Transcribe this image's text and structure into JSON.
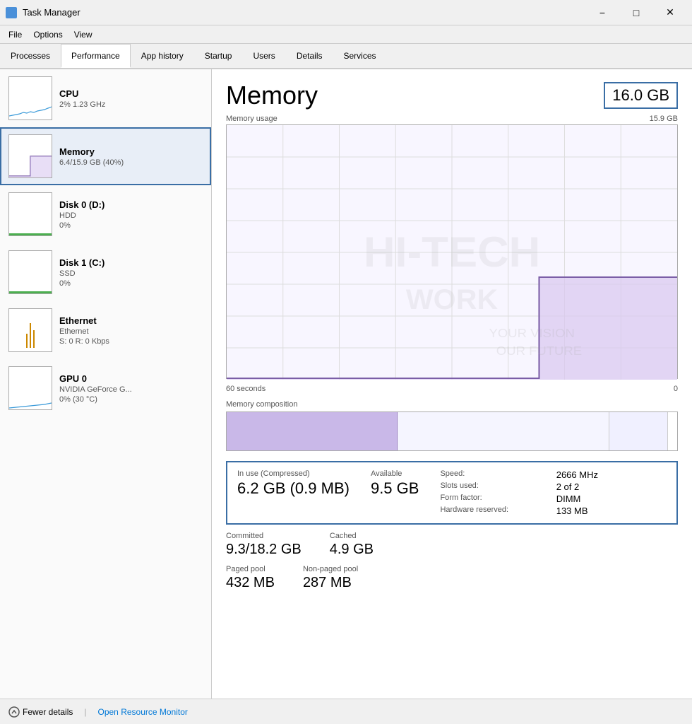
{
  "titlebar": {
    "icon_label": "task-manager-icon",
    "title": "Task Manager",
    "minimize_label": "−",
    "maximize_label": "□",
    "close_label": "✕"
  },
  "menubar": {
    "items": [
      "File",
      "Options",
      "View"
    ]
  },
  "tabs": {
    "items": [
      "Processes",
      "Performance",
      "App history",
      "Startup",
      "Users",
      "Details",
      "Services"
    ],
    "active": "Performance"
  },
  "sidebar": {
    "items": [
      {
        "name": "CPU",
        "detail1": "2% 1.23 GHz",
        "detail2": "",
        "type": "cpu",
        "active": false
      },
      {
        "name": "Memory",
        "detail1": "6.4/15.9 GB (40%)",
        "detail2": "",
        "type": "memory",
        "active": true
      },
      {
        "name": "Disk 0 (D:)",
        "detail1": "HDD",
        "detail2": "0%",
        "type": "disk",
        "active": false
      },
      {
        "name": "Disk 1 (C:)",
        "detail1": "SSD",
        "detail2": "0%",
        "type": "disk1",
        "active": false
      },
      {
        "name": "Ethernet",
        "detail1": "Ethernet",
        "detail2": "S: 0 R: 0 Kbps",
        "type": "ethernet",
        "active": false
      },
      {
        "name": "GPU 0",
        "detail1": "NVIDIA GeForce G...",
        "detail2": "0% (30 °C)",
        "type": "gpu",
        "active": false
      }
    ]
  },
  "content": {
    "title": "Memory",
    "total_value": "16.0 GB",
    "chart_label": "Memory usage",
    "chart_max": "15.9 GB",
    "chart_min": "0",
    "time_label_left": "60 seconds",
    "time_label_right": "0",
    "composition_label": "Memory composition",
    "stats": {
      "in_use_label": "In use (Compressed)",
      "in_use_value": "6.2 GB (0.9 MB)",
      "available_label": "Available",
      "available_value": "9.5 GB",
      "speed_label": "Speed:",
      "speed_value": "2666 MHz",
      "slots_label": "Slots used:",
      "slots_value": "2 of 2",
      "form_label": "Form factor:",
      "form_value": "DIMM",
      "hw_reserved_label": "Hardware reserved:",
      "hw_reserved_value": "133 MB"
    },
    "committed_label": "Committed",
    "committed_value": "9.3/18.2 GB",
    "cached_label": "Cached",
    "cached_value": "4.9 GB",
    "paged_label": "Paged pool",
    "paged_value": "432 MB",
    "nonpaged_label": "Non-paged pool",
    "nonpaged_value": "287 MB"
  },
  "bottombar": {
    "fewer_details_label": "Fewer details",
    "open_resource_label": "Open Resource Monitor",
    "separator": "|"
  }
}
